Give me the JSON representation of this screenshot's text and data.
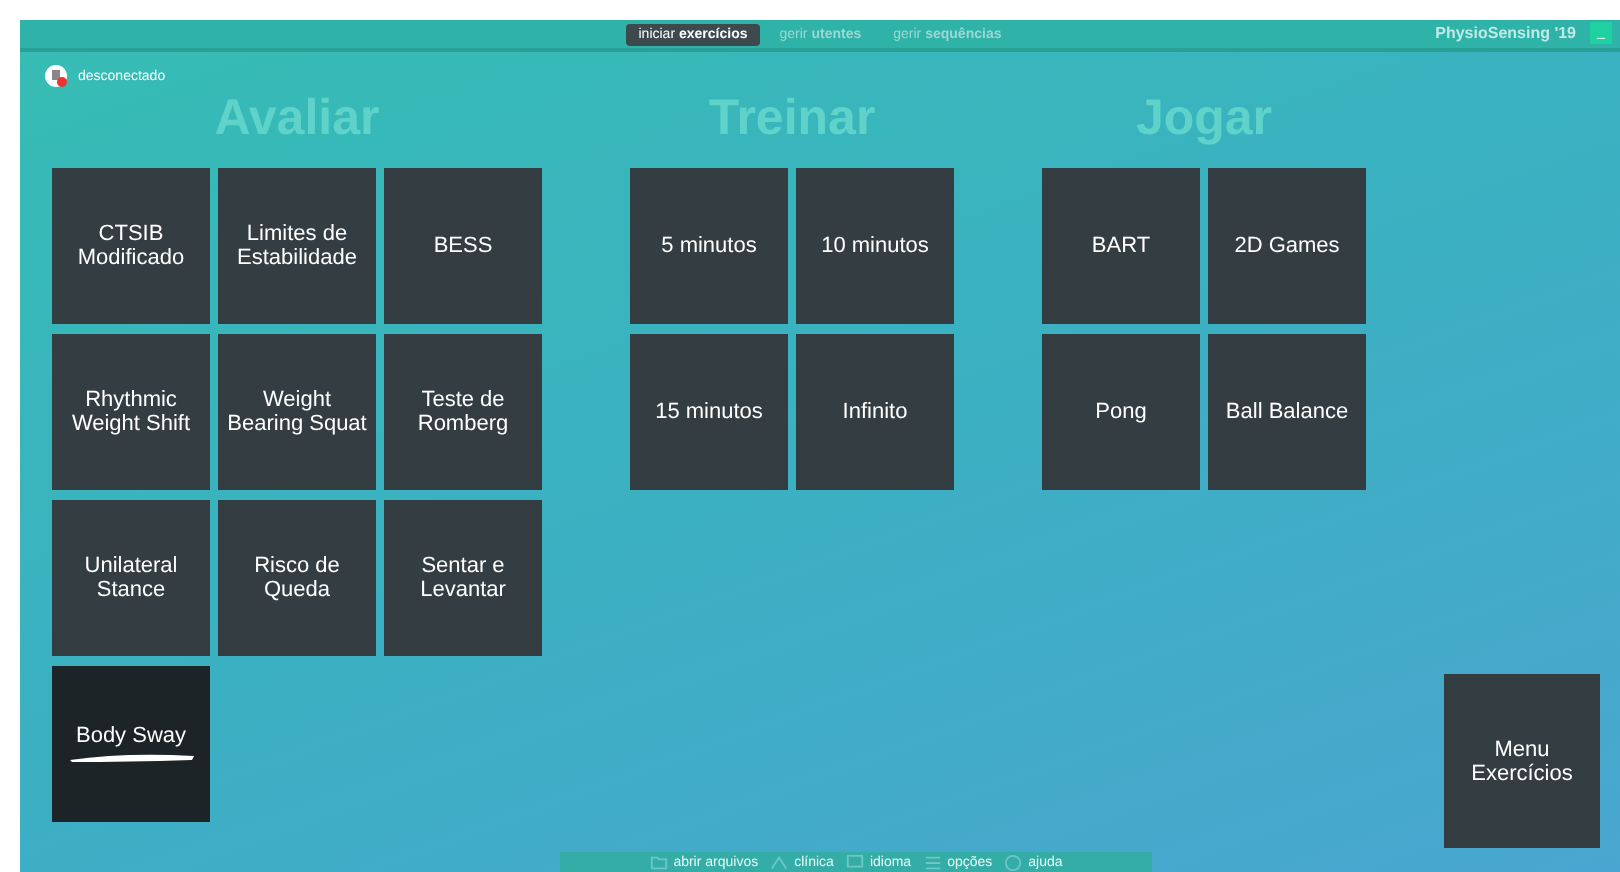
{
  "top_bar": {
    "tabs": [
      {
        "prefix": "iniciar",
        "label": "exercícios",
        "selected": true
      },
      {
        "prefix": "gerir",
        "label": "utentes",
        "selected": false
      },
      {
        "prefix": "gerir",
        "label": "sequências",
        "selected": false
      }
    ],
    "brand": "PhysioSensing '19",
    "minimize": "_"
  },
  "connection": {
    "status": "desconectado",
    "connected": false
  },
  "sections": [
    {
      "title": "Avaliar",
      "tiles": [
        {
          "label": "CTSIB Modificado",
          "selected": false
        },
        {
          "label": "Limites de Estabilidade",
          "selected": false
        },
        {
          "label": "BESS",
          "selected": false
        },
        {
          "label": "Rhythmic Weight Shift",
          "selected": false
        },
        {
          "label": "Weight Bearing Squat",
          "selected": false
        },
        {
          "label": "Teste de Romberg",
          "selected": false
        },
        {
          "label": "Unilateral Stance",
          "selected": false
        },
        {
          "label": "Risco de Queda",
          "selected": false
        },
        {
          "label": "Sentar e Levantar",
          "selected": false
        },
        {
          "label": "Body Sway",
          "selected": true
        }
      ]
    },
    {
      "title": "Treinar",
      "tiles": [
        {
          "label": "5 minutos",
          "selected": false
        },
        {
          "label": "10 minutos",
          "selected": false
        },
        {
          "label": "15 minutos",
          "selected": false
        },
        {
          "label": "Infinito",
          "selected": false
        }
      ]
    },
    {
      "title": "Jogar",
      "tiles": [
        {
          "label": "BART",
          "selected": false
        },
        {
          "label": "2D Games",
          "selected": false
        },
        {
          "label": "Pong",
          "selected": false
        },
        {
          "label": "Ball Balance",
          "selected": false
        }
      ]
    }
  ],
  "menu_button": "Menu Exercícios",
  "bottom_bar": [
    {
      "kind": "folder",
      "label": "abrir arquivos"
    },
    {
      "kind": "home",
      "label": "clínica"
    },
    {
      "kind": "screen",
      "label": "idioma"
    },
    {
      "kind": "list",
      "label": "opções"
    },
    {
      "kind": "help",
      "label": "ajuda"
    }
  ]
}
